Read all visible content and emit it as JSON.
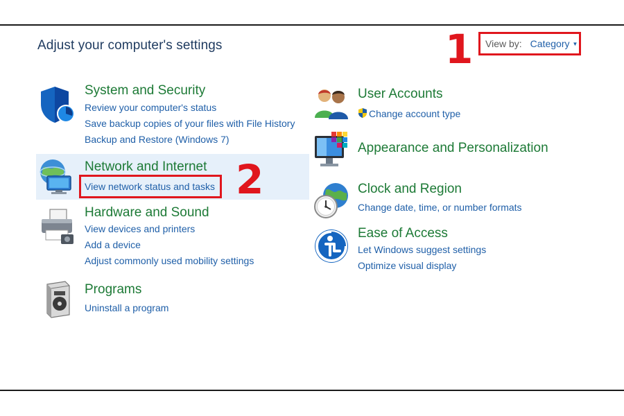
{
  "page": {
    "title": "Adjust your computer's settings",
    "view_by_label": "View by:",
    "view_by_value": "Category",
    "step_markers": [
      "1",
      "2"
    ]
  },
  "categories_left": [
    {
      "title": "System and Security",
      "icon": "shield-icon",
      "links": [
        "Review your computer's status",
        "Save backup copies of your files with File History",
        "Backup and Restore (Windows 7)"
      ]
    },
    {
      "title": "Network and Internet",
      "icon": "network-globe-icon",
      "links": [
        "View network status and tasks"
      ]
    },
    {
      "title": "Hardware and Sound",
      "icon": "printer-icon",
      "links": [
        "View devices and printers",
        "Add a device",
        "Adjust commonly used mobility settings"
      ]
    },
    {
      "title": "Programs",
      "icon": "programs-box-icon",
      "links": [
        "Uninstall a program"
      ]
    }
  ],
  "categories_right": [
    {
      "title": "User Accounts",
      "icon": "users-icon",
      "links": [
        "Change account type"
      ]
    },
    {
      "title": "Appearance and Personalization",
      "icon": "monitor-palette-icon",
      "links": []
    },
    {
      "title": "Clock and Region",
      "icon": "clock-globe-icon",
      "links": [
        "Change date, time, or number formats"
      ]
    },
    {
      "title": "Ease of Access",
      "icon": "ease-of-access-icon",
      "links": [
        "Let Windows suggest settings",
        "Optimize visual display"
      ]
    }
  ],
  "colors": {
    "category_title": "#1d7a36",
    "link": "#1f5fa8",
    "annotation_red": "#e0161d",
    "highlight": "#e6f0fa"
  }
}
